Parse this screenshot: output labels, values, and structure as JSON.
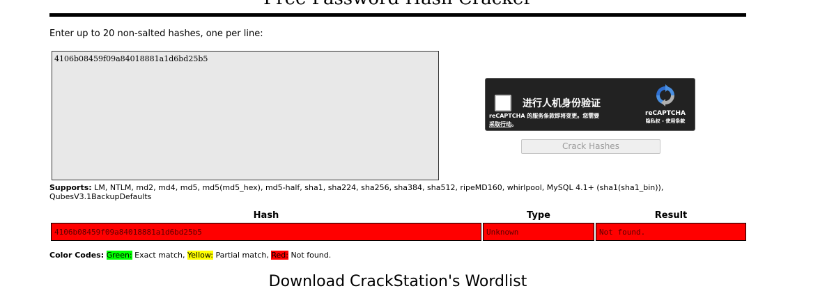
{
  "header": {
    "title": "Free Password Hash Cracker"
  },
  "form": {
    "instructions": "Enter up to 20 non-salted hashes, one per line:",
    "textarea_value": "4106b08459f09a84018881a1d6bd25b5",
    "crack_button_label": "Crack Hashes"
  },
  "recaptcha": {
    "label": "进行人机身份验证",
    "terms_line1": "reCAPTCHA 的服务条款即将变更。您需要",
    "terms_link": "采取行动",
    "terms_suffix": "。",
    "brand": "reCAPTCHA",
    "privacy": "隐私权 - 使用条款",
    "logo_icon": "recaptcha-logo-icon",
    "colors": {
      "background": "#222222",
      "logo_blue": "#4a90e2",
      "logo_gray": "#b0b0b0"
    }
  },
  "supports": {
    "label": "Supports:",
    "text": "LM, NTLM, md2, md4, md5, md5(md5_hex), md5-half, sha1, sha224, sha256, sha384, sha512, ripeMD160, whirlpool, MySQL 4.1+ (sha1(sha1_bin)), QubesV3.1BackupDefaults"
  },
  "results": {
    "headers": [
      "Hash",
      "Type",
      "Result"
    ],
    "rows": [
      {
        "hash": "4106b08459f09a84018881a1d6bd25b5",
        "type": "Unknown",
        "result": "Not found.",
        "status_color": "#ff0000"
      }
    ]
  },
  "color_codes": {
    "label": "Color Codes:",
    "green_label": "Green:",
    "green_text": "Exact match,",
    "yellow_label": "Yellow:",
    "yellow_text": "Partial match,",
    "red_label": "Red:",
    "red_text": "Not found.",
    "colors": {
      "green": "#00ff00",
      "yellow": "#ffff00",
      "red": "#ff0000"
    }
  },
  "download": {
    "heading": "Download CrackStation's Wordlist"
  }
}
